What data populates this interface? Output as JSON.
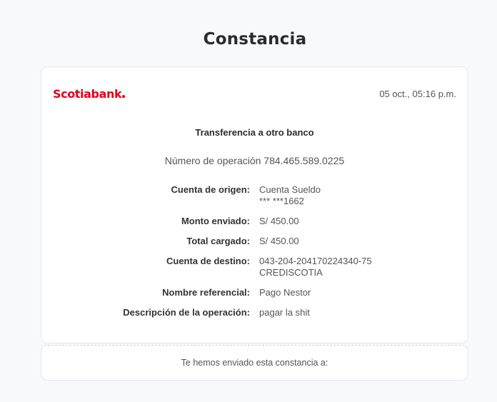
{
  "page": {
    "title": "Constancia"
  },
  "receipt": {
    "bank_name": "Scotiabank",
    "brand_color": "#e2001a",
    "date": "05 oct., 05:16 p.m.",
    "subtitle": "Transferencia a otro banco",
    "operation_number": "Número de operación 784.465.589.0225",
    "rows": [
      {
        "label": "Cuenta de origen:",
        "value_line1": "Cuenta Sueldo",
        "value_line2": "*** ***1662"
      },
      {
        "label": "Monto enviado:",
        "value_line1": "S/ 450.00"
      },
      {
        "label": "Total cargado:",
        "value_line1": "S/ 450.00"
      },
      {
        "label": "Cuenta de destino:",
        "value_line1": "043-204-204170224340-75",
        "value_line2": "CREDISCOTIA"
      },
      {
        "label": "Nombre referencial:",
        "value_line1": "Pago Nestor"
      },
      {
        "label": "Descripción de la operación:",
        "value_line1": "pagar la shit"
      }
    ]
  },
  "footer": {
    "sent_to_text": "Te hemos enviado esta constancia a:"
  }
}
